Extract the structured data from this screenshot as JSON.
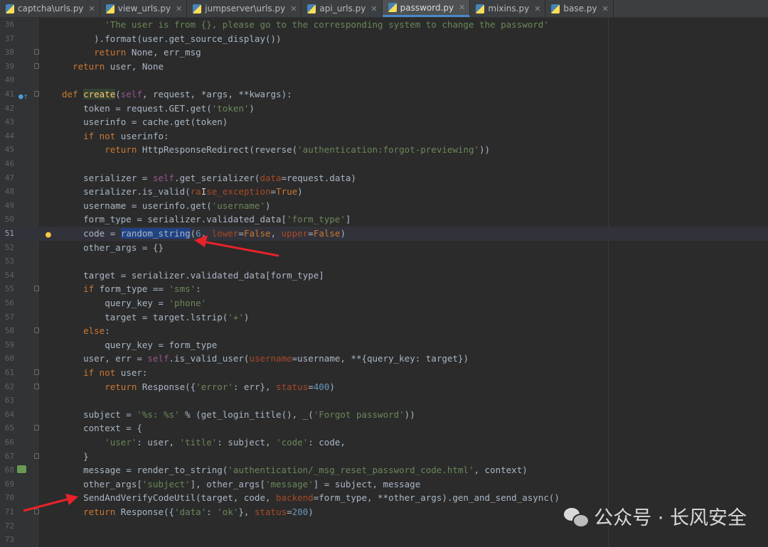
{
  "tabs": [
    {
      "label": "captcha\\urls.py",
      "active": false
    },
    {
      "label": "view_urls.py",
      "active": false
    },
    {
      "label": "jumpserver\\urls.py",
      "active": false
    },
    {
      "label": "api_urls.py",
      "active": false
    },
    {
      "label": "password.py",
      "active": true
    },
    {
      "label": "mixins.py",
      "active": false
    },
    {
      "label": "base.py",
      "active": false
    }
  ],
  "close_glyph": "✕",
  "lines": [
    {
      "n": "36",
      "seg": [
        [
          "        'The user is from {}, please go to the corresponding system to change the password'",
          "str"
        ]
      ],
      "fold": false
    },
    {
      "n": "37",
      "seg": [
        [
          "      ).format(user.get_source_display())",
          ""
        ]
      ],
      "fold": false
    },
    {
      "n": "38",
      "seg": [
        [
          "      ",
          ""
        ],
        [
          "return",
          "kw"
        ],
        [
          " None, err_msg",
          ""
        ]
      ],
      "fold": true
    },
    {
      "n": "39",
      "seg": [
        [
          "  ",
          ""
        ],
        [
          "return",
          "kw"
        ],
        [
          " user, None",
          ""
        ]
      ],
      "fold": true
    },
    {
      "n": "40",
      "seg": [],
      "fold": false
    },
    {
      "n": "41",
      "seg": [
        [
          "def",
          "kw"
        ],
        [
          " ",
          ""
        ],
        [
          "create",
          "fn hlfn"
        ],
        [
          "(",
          ""
        ],
        [
          "self",
          "slf"
        ],
        [
          ", request, *args, **kwargs):",
          ""
        ]
      ],
      "fold": true,
      "icon": "override"
    },
    {
      "n": "42",
      "seg": [
        [
          "    token = request.GET.get(",
          ""
        ],
        [
          "'token'",
          "str"
        ],
        [
          ")",
          ""
        ]
      ],
      "fold": false
    },
    {
      "n": "43",
      "seg": [
        [
          "    userinfo = cache.get(token)",
          ""
        ]
      ],
      "fold": false
    },
    {
      "n": "44",
      "seg": [
        [
          "    ",
          ""
        ],
        [
          "if not",
          "kw"
        ],
        [
          " userinfo:",
          ""
        ]
      ],
      "fold": false
    },
    {
      "n": "45",
      "seg": [
        [
          "        ",
          ""
        ],
        [
          "return",
          "kw"
        ],
        [
          " HttpResponseRedirect(reverse(",
          ""
        ],
        [
          "'authentication:forgot-previewing'",
          "str"
        ],
        [
          "))",
          ""
        ]
      ],
      "fold": false
    },
    {
      "n": "46",
      "seg": [],
      "fold": false
    },
    {
      "n": "47",
      "seg": [
        [
          "    serializer = ",
          ""
        ],
        [
          "self",
          "slf"
        ],
        [
          ".get_serializer(",
          ""
        ],
        [
          "data",
          "prm"
        ],
        [
          "=request.data)",
          ""
        ]
      ],
      "fold": false
    },
    {
      "n": "48",
      "seg": [
        [
          "    serializer.is_valid(",
          ""
        ],
        [
          "ra",
          "prm"
        ],
        [
          "I",
          "cursor"
        ],
        [
          "se_exception",
          "prm"
        ],
        [
          "=",
          ""
        ],
        [
          "True",
          "kw"
        ],
        [
          ")",
          ""
        ]
      ],
      "fold": false
    },
    {
      "n": "49",
      "seg": [
        [
          "    username = userinfo.get(",
          ""
        ],
        [
          "'username'",
          "str"
        ],
        [
          ")",
          ""
        ]
      ],
      "fold": false
    },
    {
      "n": "50",
      "seg": [
        [
          "    form_type = serializer.validated_data[",
          ""
        ],
        [
          "'form_type'",
          "str"
        ],
        [
          "]",
          ""
        ]
      ],
      "fold": false
    },
    {
      "n": "51",
      "seg": [
        [
          "    code = ",
          ""
        ],
        [
          "random_string",
          "sel"
        ],
        [
          "(",
          ""
        ],
        [
          "6",
          "num"
        ],
        [
          ", ",
          ""
        ],
        [
          "lower",
          "prm"
        ],
        [
          "=",
          ""
        ],
        [
          "False",
          "kw"
        ],
        [
          ", ",
          ""
        ],
        [
          "upper",
          "prm"
        ],
        [
          "=",
          ""
        ],
        [
          "False",
          "kw"
        ],
        [
          ")",
          ""
        ]
      ],
      "fold": false,
      "current": true,
      "icon": "bulb"
    },
    {
      "n": "52",
      "seg": [
        [
          "    other_args = {}",
          ""
        ]
      ],
      "fold": false
    },
    {
      "n": "53",
      "seg": [],
      "fold": false
    },
    {
      "n": "54",
      "seg": [
        [
          "    target = serializer.validated_data[form_type]",
          ""
        ]
      ],
      "fold": false
    },
    {
      "n": "55",
      "seg": [
        [
          "    ",
          ""
        ],
        [
          "if",
          "kw"
        ],
        [
          " form_type == ",
          ""
        ],
        [
          "'sms'",
          "str"
        ],
        [
          ":",
          ""
        ]
      ],
      "fold": true
    },
    {
      "n": "56",
      "seg": [
        [
          "        query_key = ",
          ""
        ],
        [
          "'phone'",
          "str"
        ]
      ],
      "fold": false
    },
    {
      "n": "57",
      "seg": [
        [
          "        target = target.lstrip(",
          ""
        ],
        [
          "'+'",
          "str"
        ],
        [
          ")",
          ""
        ]
      ],
      "fold": false
    },
    {
      "n": "58",
      "seg": [
        [
          "    ",
          ""
        ],
        [
          "else",
          "kw"
        ],
        [
          ":",
          ""
        ]
      ],
      "fold": true
    },
    {
      "n": "59",
      "seg": [
        [
          "        query_key = form_type",
          ""
        ]
      ],
      "fold": false
    },
    {
      "n": "60",
      "seg": [
        [
          "    user, err = ",
          ""
        ],
        [
          "self",
          "slf"
        ],
        [
          ".is_valid_user(",
          ""
        ],
        [
          "username",
          "prm"
        ],
        [
          "=username, **{query_key: target})",
          ""
        ]
      ],
      "fold": false
    },
    {
      "n": "61",
      "seg": [
        [
          "    ",
          ""
        ],
        [
          "if not",
          "kw"
        ],
        [
          " user:",
          ""
        ]
      ],
      "fold": true
    },
    {
      "n": "62",
      "seg": [
        [
          "        ",
          ""
        ],
        [
          "return",
          "kw"
        ],
        [
          " Response({",
          ""
        ],
        [
          "'error'",
          "str"
        ],
        [
          ": err}, ",
          ""
        ],
        [
          "status",
          "prm"
        ],
        [
          "=",
          ""
        ],
        [
          "400",
          "num"
        ],
        [
          ")",
          ""
        ]
      ],
      "fold": true
    },
    {
      "n": "63",
      "seg": [],
      "fold": false
    },
    {
      "n": "64",
      "seg": [
        [
          "    subject = ",
          ""
        ],
        [
          "'%s: %s'",
          "str"
        ],
        [
          " % (get_login_title(), _(",
          ""
        ],
        [
          "'Forgot password'",
          "str"
        ],
        [
          "))",
          ""
        ]
      ],
      "fold": false
    },
    {
      "n": "65",
      "seg": [
        [
          "    context = {",
          ""
        ]
      ],
      "fold": true
    },
    {
      "n": "66",
      "seg": [
        [
          "        ",
          ""
        ],
        [
          "'user'",
          "str"
        ],
        [
          ": user, ",
          ""
        ],
        [
          "'title'",
          "str"
        ],
        [
          ": subject, ",
          ""
        ],
        [
          "'code'",
          "str"
        ],
        [
          ": code,",
          ""
        ]
      ],
      "fold": false
    },
    {
      "n": "67",
      "seg": [
        [
          "    }",
          ""
        ]
      ],
      "fold": true
    },
    {
      "n": "68",
      "seg": [
        [
          "    message = render_to_string(",
          ""
        ],
        [
          "'authentication/_msg_reset_password_code.html'",
          "str"
        ],
        [
          ", context)",
          ""
        ]
      ],
      "fold": false,
      "icon": "run"
    },
    {
      "n": "69",
      "seg": [
        [
          "    other_args[",
          ""
        ],
        [
          "'subject'",
          "str"
        ],
        [
          "], other_args[",
          ""
        ],
        [
          "'message'",
          "str"
        ],
        [
          "] = subject, message",
          ""
        ]
      ],
      "fold": false
    },
    {
      "n": "70",
      "seg": [
        [
          "    SendAndVerifyCodeUtil(target, code, ",
          ""
        ],
        [
          "backend",
          "prm"
        ],
        [
          "=form_type, **other_args).gen_and_send_async()",
          ""
        ]
      ],
      "fold": false
    },
    {
      "n": "71",
      "seg": [
        [
          "    ",
          ""
        ],
        [
          "return",
          "kw"
        ],
        [
          " Response({",
          ""
        ],
        [
          "'data'",
          "str"
        ],
        [
          ": ",
          ""
        ],
        [
          "'ok'",
          "str"
        ],
        [
          "}, ",
          ""
        ],
        [
          "status",
          "prm"
        ],
        [
          "=",
          ""
        ],
        [
          "200",
          "num"
        ],
        [
          ")",
          ""
        ]
      ],
      "fold": true
    },
    {
      "n": "72",
      "seg": [],
      "fold": false
    },
    {
      "n": "73",
      "seg": [],
      "fold": false
    }
  ],
  "watermark": {
    "separator": "公众号 · 长风安全"
  },
  "colors": {
    "background": "#2b2b2b",
    "keyword": "#cc7832",
    "string": "#6a8759",
    "arrow": "#e8222a"
  }
}
